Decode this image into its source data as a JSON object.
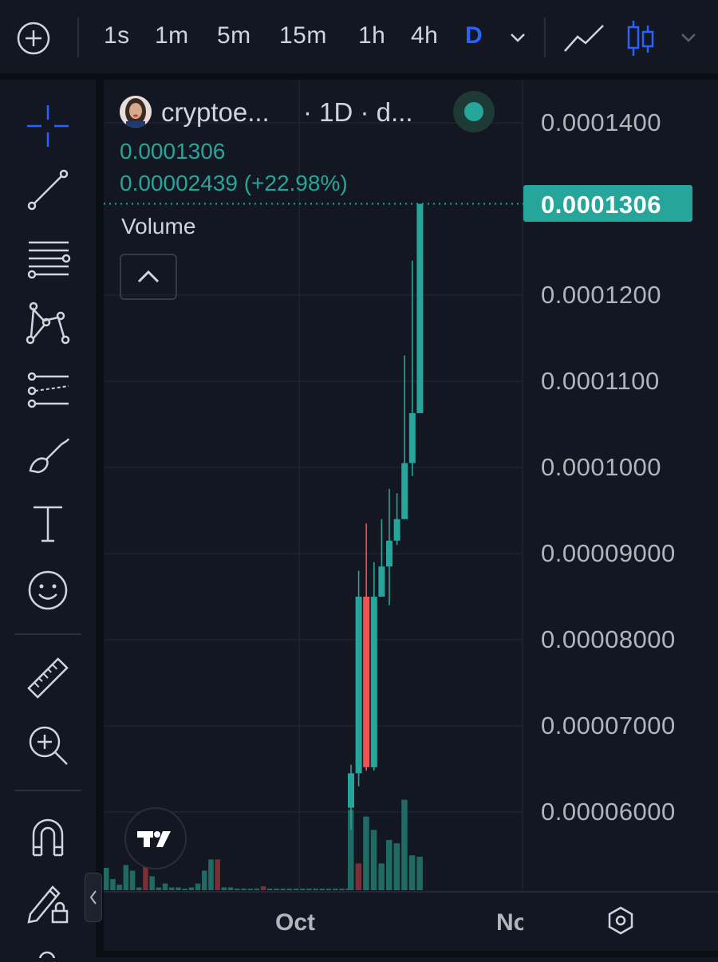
{
  "toolbar": {
    "timeframes": [
      "1s",
      "1m",
      "5m",
      "15m",
      "1h",
      "4h",
      "D"
    ],
    "active_timeframe": "D"
  },
  "legend": {
    "symbol": "cryptoe...",
    "interval": "· 1D · d...",
    "last_price": "0.0001306",
    "change": "0.00002439 (+22.98%)"
  },
  "volume": {
    "label": "Volume"
  },
  "price_axis": {
    "labels": [
      "0.0001400",
      "0.0001200",
      "0.0001100",
      "0.0001000",
      "0.00009000",
      "0.00008000",
      "0.00007000",
      "0.00006000"
    ],
    "current_price": "0.0001306"
  },
  "time_axis": {
    "labels": [
      "Oct",
      "No"
    ]
  },
  "colors": {
    "background": "#131722",
    "up": "#26a69a",
    "down": "#ef5350",
    "accent": "#2962ff"
  },
  "chart_data": {
    "type": "candlestick",
    "interval": "1D",
    "price_ticks": [
      6e-05,
      7e-05,
      8e-05,
      9e-05,
      0.0001,
      0.00011,
      0.00012,
      0.00014
    ],
    "last": 0.0001306,
    "change": 2.439e-05,
    "change_pct": 22.98,
    "candles": [
      {
        "o": 6.05e-05,
        "h": 6.55e-05,
        "l": 5.8e-05,
        "c": 6.45e-05
      },
      {
        "o": 6.45e-05,
        "h": 8.8e-05,
        "l": 6.3e-05,
        "c": 8.5e-05
      },
      {
        "o": 8.5e-05,
        "h": 9.35e-05,
        "l": 6.48e-05,
        "c": 6.52e-05
      },
      {
        "o": 6.52e-05,
        "h": 8.9e-05,
        "l": 6.48e-05,
        "c": 8.5e-05
      },
      {
        "o": 8.5e-05,
        "h": 9.4e-05,
        "l": 8.5e-05,
        "c": 8.85e-05
      },
      {
        "o": 8.85e-05,
        "h": 9.75e-05,
        "l": 8.4e-05,
        "c": 9.15e-05
      },
      {
        "o": 9.15e-05,
        "h": 9.7e-05,
        "l": 9.1e-05,
        "c": 9.4e-05
      },
      {
        "o": 9.4e-05,
        "h": 0.000113,
        "l": 9.4e-05,
        "c": 0.0001005
      },
      {
        "o": 0.0001005,
        "h": 0.000124,
        "l": 9.9e-05,
        "c": 0.0001063
      },
      {
        "o": 0.0001063,
        "h": 0.0001306,
        "l": 0.0001063,
        "c": 0.0001306
      }
    ],
    "volume_early": [
      0.4,
      0.2,
      0.1,
      0.45,
      0.35,
      0.05,
      0.45,
      0.25,
      0.05,
      0.12,
      0.05,
      0.05,
      0.02,
      0.05,
      0.12,
      0.35,
      0.55,
      0.55,
      0.05,
      0.05,
      0.03,
      0.03,
      0.02,
      0.03,
      0.07,
      0.02,
      0.02,
      0.02,
      0.02,
      0.02,
      0.02,
      0.03,
      0.02,
      0.02,
      0.02,
      0.02,
      0.02,
      0.02
    ],
    "volume_early_down": [
      false,
      false,
      false,
      false,
      false,
      false,
      true,
      false,
      false,
      false,
      false,
      false,
      false,
      false,
      false,
      false,
      false,
      true,
      false,
      false,
      false,
      false,
      false,
      false,
      true,
      false,
      false,
      false,
      false,
      false,
      false,
      false,
      false,
      false,
      false,
      false,
      false,
      false
    ],
    "volume_late": [
      1.2,
      0.4,
      1.1,
      0.9,
      0.4,
      0.75,
      0.7,
      1.35,
      0.52,
      0.5
    ],
    "volume_late_down": [
      false,
      true,
      false,
      false,
      false,
      false,
      false,
      false,
      false,
      false
    ]
  }
}
